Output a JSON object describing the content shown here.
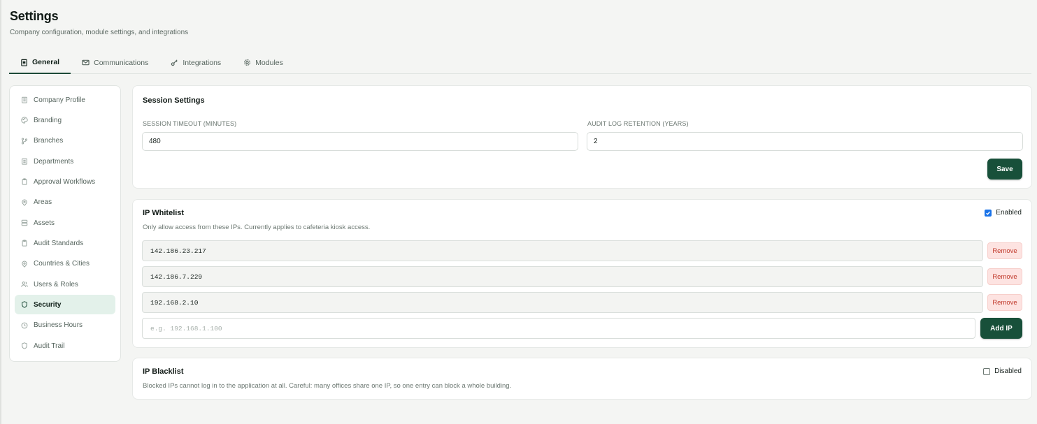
{
  "header": {
    "title": "Settings",
    "subtitle": "Company configuration, module settings, and integrations"
  },
  "tabs": [
    {
      "label": "General",
      "icon": "building-icon",
      "active": true
    },
    {
      "label": "Communications",
      "icon": "mail-icon",
      "active": false
    },
    {
      "label": "Integrations",
      "icon": "key-icon",
      "active": false
    },
    {
      "label": "Modules",
      "icon": "gear-icon",
      "active": false
    }
  ],
  "sidebar": {
    "items": [
      {
        "label": "Company Profile",
        "icon": "building-icon"
      },
      {
        "label": "Branding",
        "icon": "palette-icon"
      },
      {
        "label": "Branches",
        "icon": "git-branch-icon"
      },
      {
        "label": "Departments",
        "icon": "building-icon"
      },
      {
        "label": "Approval Workflows",
        "icon": "clipboard-icon"
      },
      {
        "label": "Areas",
        "icon": "map-pin-icon"
      },
      {
        "label": "Assets",
        "icon": "server-icon"
      },
      {
        "label": "Audit Standards",
        "icon": "clipboard-icon"
      },
      {
        "label": "Countries & Cities",
        "icon": "map-pin-icon"
      },
      {
        "label": "Users & Roles",
        "icon": "users-icon"
      },
      {
        "label": "Security",
        "icon": "shield-icon",
        "active": true
      },
      {
        "label": "Business Hours",
        "icon": "clock-icon"
      },
      {
        "label": "Audit Trail",
        "icon": "shield-icon"
      }
    ]
  },
  "session": {
    "title": "Session Settings",
    "timeout_label": "SESSION TIMEOUT (MINUTES)",
    "timeout_value": "480",
    "retention_label": "AUDIT LOG RETENTION (YEARS)",
    "retention_value": "2",
    "save_label": "Save"
  },
  "whitelist": {
    "title": "IP Whitelist",
    "description": "Only allow access from these IPs. Currently applies to cafeteria kiosk access.",
    "toggle_label": "Enabled",
    "enabled": true,
    "ips": [
      "142.186.23.217",
      "142.186.7.229",
      "192.168.2.10"
    ],
    "remove_label": "Remove",
    "input_placeholder": "e.g. 192.168.1.100",
    "add_label": "Add IP"
  },
  "blacklist": {
    "title": "IP Blacklist",
    "description": "Blocked IPs cannot log in to the application at all. Careful: many offices share one IP, so one entry can block a whole building.",
    "toggle_label": "Disabled",
    "enabled": false
  },
  "colors": {
    "accent": "#18503a",
    "active_bg": "#e3f1ea",
    "danger": "#c0392b",
    "danger_bg": "#fde3e1"
  }
}
